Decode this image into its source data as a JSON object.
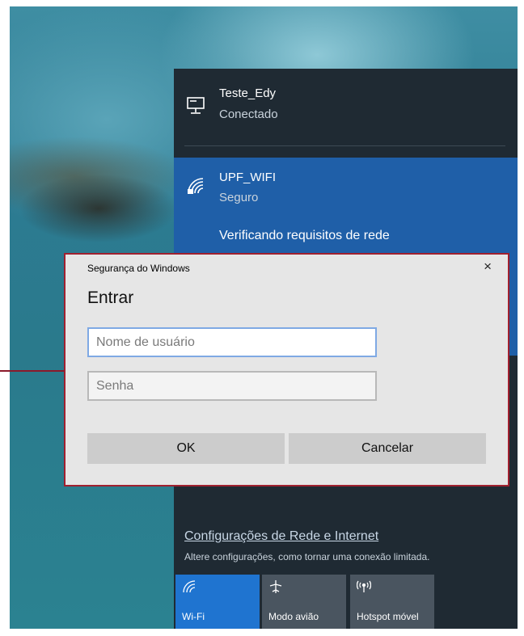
{
  "networks": {
    "current": {
      "name": "Teste_Edy",
      "status": "Conectado",
      "icon": "ethernet-icon"
    },
    "selected": {
      "name": "UPF_WIFI",
      "status": "Seguro",
      "progress_text": "Verificando requisitos de rede",
      "icon": "wifi-secure-icon"
    }
  },
  "dialog": {
    "window_title": "Segurança do Windows",
    "heading": "Entrar",
    "username": {
      "value": "",
      "placeholder": "Nome de usuário"
    },
    "password": {
      "value": "",
      "placeholder": "Senha"
    },
    "ok_label": "OK",
    "cancel_label": "Cancelar",
    "close_glyph": "×"
  },
  "settings": {
    "link_label": "Configurações de Rede e Internet",
    "description": "Altere configurações, como tornar uma conexão limitada."
  },
  "quick_actions": [
    {
      "label": "Wi-Fi",
      "icon": "wifi-icon",
      "active": true
    },
    {
      "label": "Modo avião",
      "icon": "airplane-icon",
      "active": false
    },
    {
      "label": "Hotspot móvel",
      "icon": "hotspot-icon",
      "active": false
    }
  ],
  "colors": {
    "accent": "#1f74d0",
    "selected_network": "#1f5fa8",
    "callout_border": "#a0202f"
  }
}
